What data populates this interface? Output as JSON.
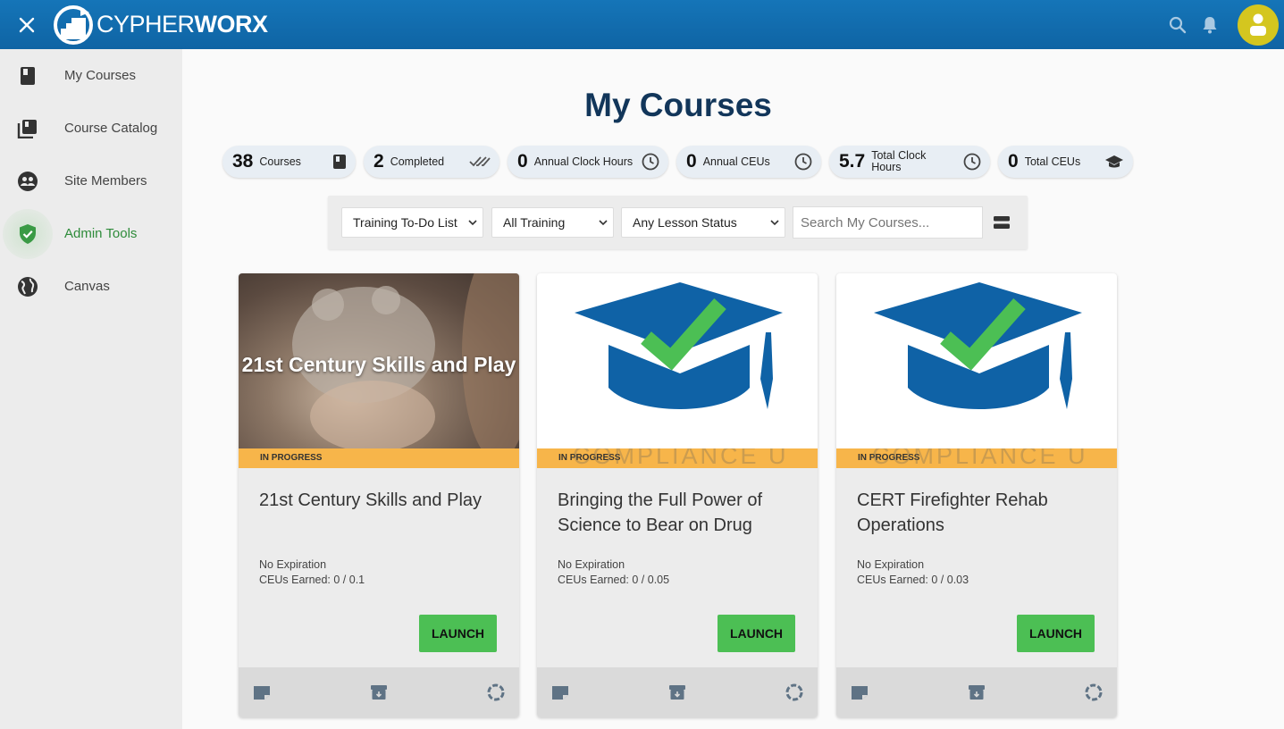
{
  "header": {
    "logo_light": "CYPHER",
    "logo_bold": "WORX"
  },
  "sidebar": {
    "items": [
      {
        "label": "My Courses",
        "icon": "book-icon"
      },
      {
        "label": "Course Catalog",
        "icon": "library-icon"
      },
      {
        "label": "Site Members",
        "icon": "members-icon"
      },
      {
        "label": "Admin Tools",
        "icon": "shield-check-icon"
      },
      {
        "label": "Canvas",
        "icon": "globe-icon"
      }
    ]
  },
  "main": {
    "title": "My Courses",
    "stats": [
      {
        "num": "38",
        "label": "Courses"
      },
      {
        "num": "2",
        "label": "Completed"
      },
      {
        "num": "0",
        "label": "Annual Clock Hours"
      },
      {
        "num": "0",
        "label": "Annual CEUs"
      },
      {
        "num": "5.7",
        "label": "Total Clock Hours"
      },
      {
        "num": "0",
        "label": "Total CEUs"
      }
    ],
    "filters": {
      "list": "Training To-Do List",
      "type": "All Training",
      "status": "Any Lesson Status",
      "search_placeholder": "Search My Courses..."
    },
    "cards": [
      {
        "thumb_title": "21st Century Skills and Play",
        "status": "IN PROGRESS",
        "title": "21st Century Skills and Play",
        "expiration": "No Expiration",
        "ceus": "CEUs Earned: 0 / 0.1",
        "launch": "LAUNCH"
      },
      {
        "watermark": "COMPLIANCE U",
        "status": "IN PROGRESS",
        "title": "Bringing the Full Power of Science to Bear on Drug",
        "expiration": "No Expiration",
        "ceus": "CEUs Earned: 0 / 0.05",
        "launch": "LAUNCH"
      },
      {
        "watermark": "COMPLIANCE U",
        "status": "IN PROGRESS",
        "title": "CERT Firefighter Rehab Operations",
        "expiration": "No Expiration",
        "ceus": "CEUs Earned: 0 / 0.03",
        "launch": "LAUNCH"
      }
    ]
  },
  "colors": {
    "header_blue": "#1575b8",
    "accent_green": "#4cbf54",
    "status_orange": "#f7b54a",
    "title_navy": "#12365a",
    "avatar_yellow": "#d4c61f"
  }
}
